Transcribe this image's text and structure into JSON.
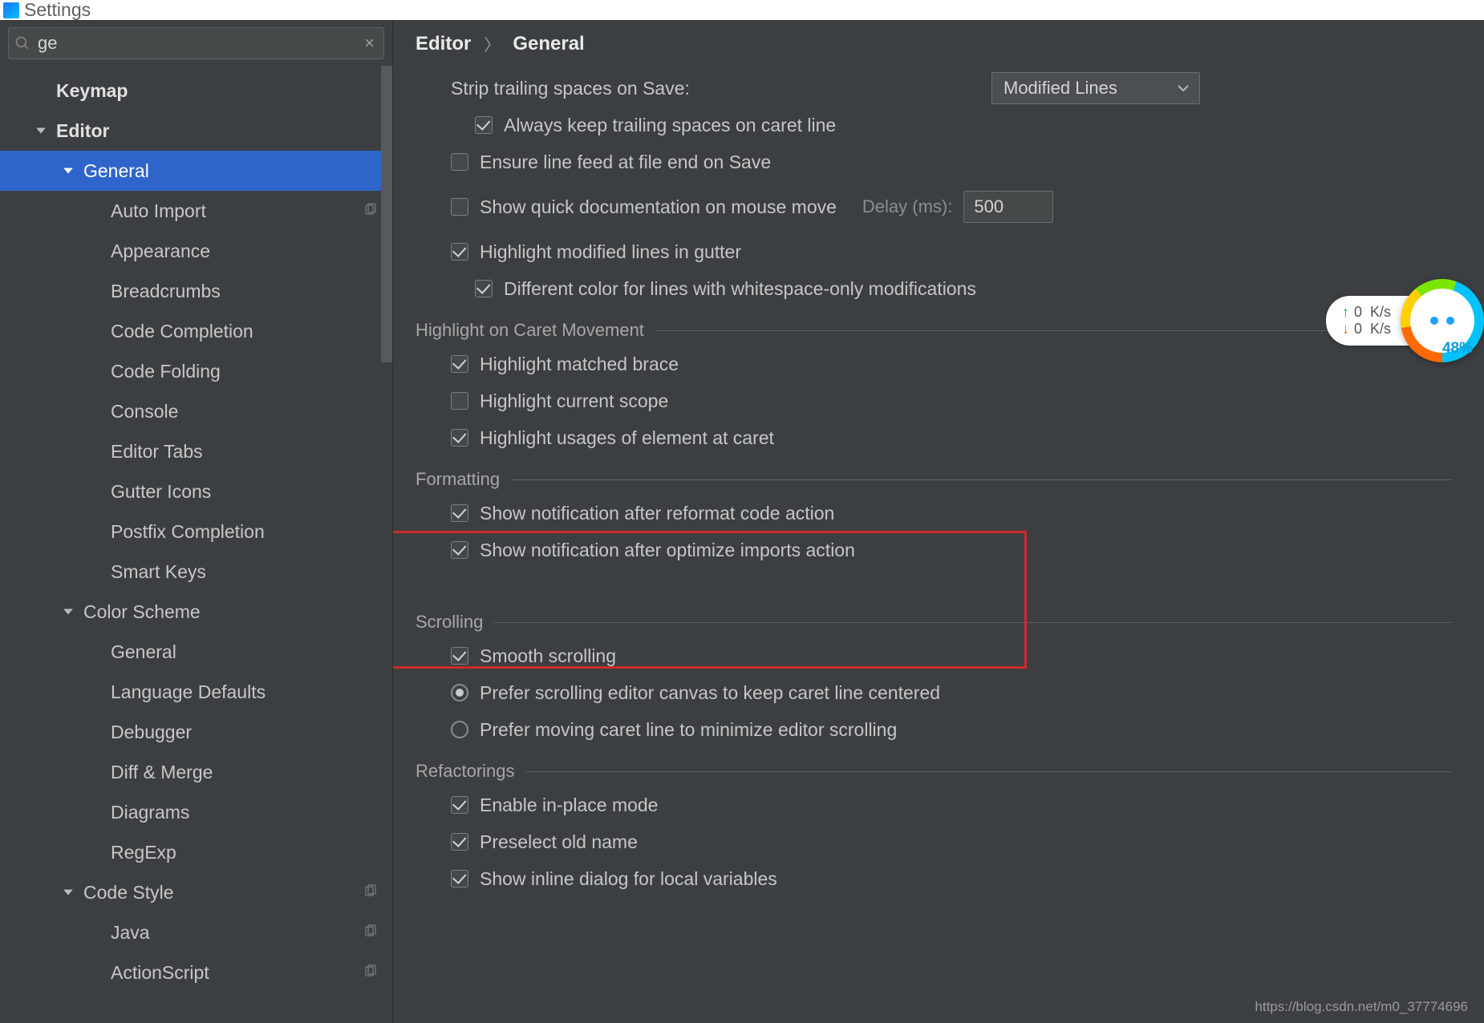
{
  "window": {
    "title": "Settings"
  },
  "search": {
    "value": "ge"
  },
  "sidebar": {
    "items": [
      {
        "label": "Keymap",
        "level": 0,
        "bold": true
      },
      {
        "label": "Editor",
        "level": 0,
        "bold": true,
        "expandable": true
      },
      {
        "label": "General",
        "level": 2,
        "selected": true,
        "expandable": true
      },
      {
        "label": "Auto Import",
        "level": 3,
        "copy": true
      },
      {
        "label": "Appearance",
        "level": 3
      },
      {
        "label": "Breadcrumbs",
        "level": 3
      },
      {
        "label": "Code Completion",
        "level": 3
      },
      {
        "label": "Code Folding",
        "level": 3
      },
      {
        "label": "Console",
        "level": 3
      },
      {
        "label": "Editor Tabs",
        "level": 3
      },
      {
        "label": "Gutter Icons",
        "level": 3
      },
      {
        "label": "Postfix Completion",
        "level": 3
      },
      {
        "label": "Smart Keys",
        "level": 3
      },
      {
        "label": "Color Scheme",
        "level": 2,
        "expandable": true
      },
      {
        "label": "General",
        "level": 3
      },
      {
        "label": "Language Defaults",
        "level": 3
      },
      {
        "label": "Debugger",
        "level": 3
      },
      {
        "label": "Diff & Merge",
        "level": 3
      },
      {
        "label": "Diagrams",
        "level": 3
      },
      {
        "label": "RegExp",
        "level": 3
      },
      {
        "label": "Code Style",
        "level": 2,
        "expandable": true,
        "copy": true
      },
      {
        "label": "Java",
        "level": 3,
        "copy": true
      },
      {
        "label": "ActionScript",
        "level": 3,
        "copy": true
      }
    ]
  },
  "breadcrumb": {
    "a": "Editor",
    "b": "General"
  },
  "settings": {
    "strip_label": "Strip trailing spaces on Save:",
    "strip_value": "Modified Lines",
    "always_keep": "Always keep trailing spaces on caret line",
    "ensure_lf": "Ensure line feed at file end on Save",
    "quick_doc": "Show quick documentation on mouse move",
    "delay_label": "Delay (ms):",
    "delay_value": "500",
    "hl_gutter": "Highlight modified lines in gutter",
    "diff_color": "Different color for lines with whitespace-only modifications",
    "sec_caret": "Highlight on Caret Movement",
    "hl_brace": "Highlight matched brace",
    "hl_scope": "Highlight current scope",
    "hl_usages": "Highlight usages of element at caret",
    "sec_fmt": "Formatting",
    "notif_refmt": "Show notification after reformat code action",
    "notif_opt": "Show notification after optimize imports action",
    "sec_scroll": "Scrolling",
    "smooth": "Smooth scrolling",
    "prefer_canvas": "Prefer scrolling editor canvas to keep caret line centered",
    "prefer_caret": "Prefer moving caret line to minimize editor scrolling",
    "sec_refac": "Refactorings",
    "inplace": "Enable in-place mode",
    "preselect": "Preselect old name",
    "inline_dlg": "Show inline dialog for local variables"
  },
  "widget": {
    "up": "0",
    "dn": "0",
    "unit": "K/s",
    "pct": "48%"
  },
  "watermark": "https://blog.csdn.net/m0_37774696"
}
